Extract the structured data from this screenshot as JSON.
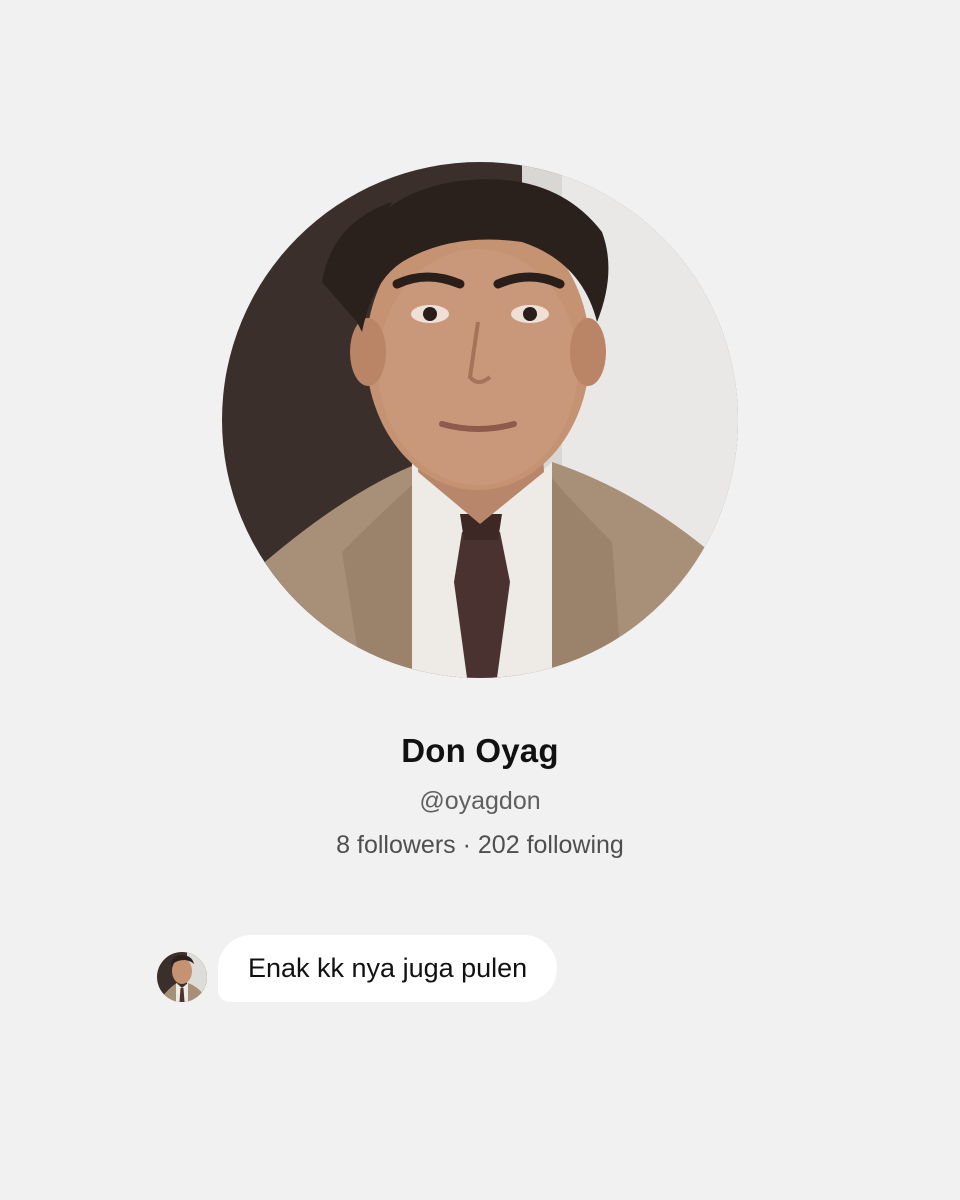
{
  "profile": {
    "avatar_icon": "profile-photo",
    "name": "Don Oyag",
    "handle": "@oyagdon",
    "followers_count": "8",
    "followers_label": "followers",
    "separator": "·",
    "following_count": "202",
    "following_label": "following"
  },
  "comment": {
    "avatar_icon": "commenter-avatar",
    "text": "Enak kk nya juga pulen"
  },
  "colors": {
    "background": "#f1f1f1",
    "bubble": "#ffffff",
    "name_text": "#111111",
    "secondary_text": "#5f5f5f"
  }
}
